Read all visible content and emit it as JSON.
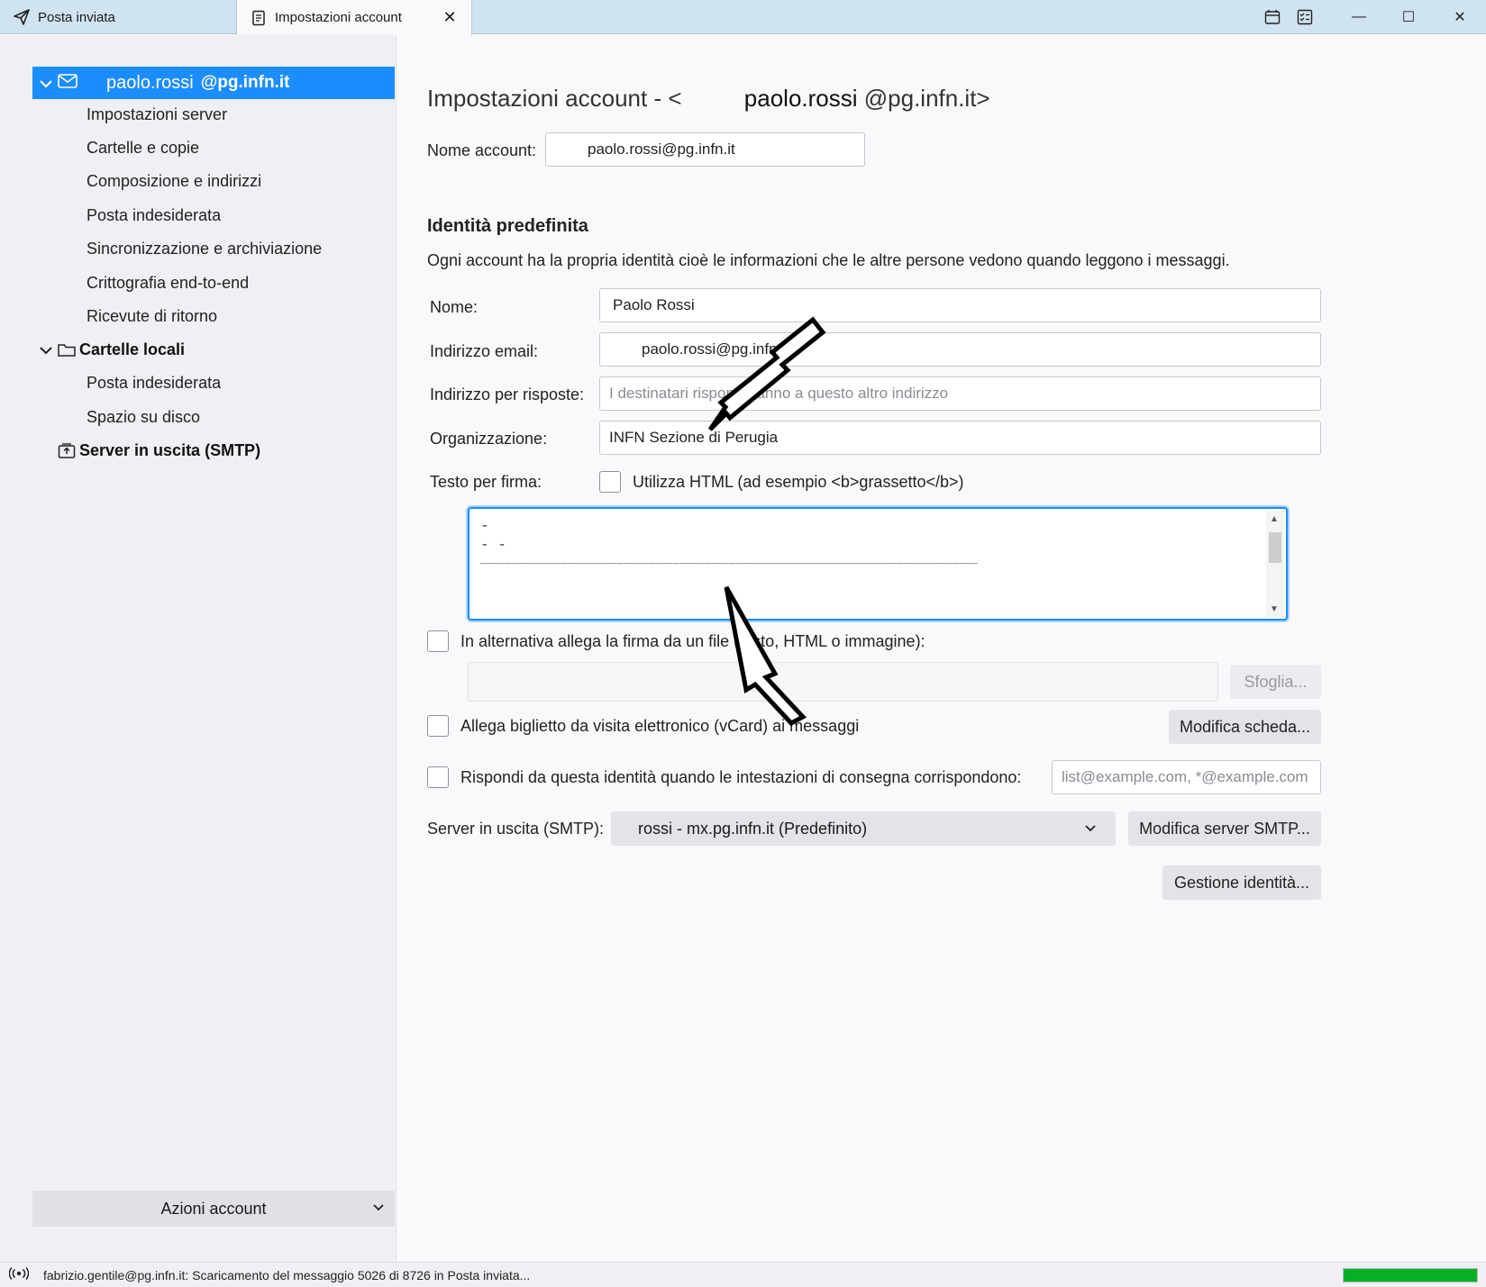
{
  "tabs": [
    {
      "label": "Posta inviata",
      "icon": "send-icon"
    },
    {
      "label": "Impostazioni account",
      "icon": "document-icon"
    }
  ],
  "sidebar": {
    "account": {
      "name": "paolo.rossi",
      "domain": "@pg.infn.it"
    },
    "account_items": [
      "Impostazioni server",
      "Cartelle e copie",
      "Composizione e indirizzi",
      "Posta indesiderata",
      "Sincronizzazione e archiviazione",
      "Crittografia end-to-end",
      "Ricevute di ritorno"
    ],
    "local_folders": {
      "label": "Cartelle locali",
      "items": [
        "Posta indesiderata",
        "Spazio su disco"
      ]
    },
    "smtp": {
      "label": "Server in uscita (SMTP)"
    },
    "actions_label": "Azioni account"
  },
  "main": {
    "title_prefix": "Impostazioni account - <",
    "title_name": "paolo.rossi",
    "title_suffix": "@pg.infn.it>",
    "account_name_label": "Nome account:",
    "account_name_value": "paolo.rossi@pg.infn.it",
    "identity_heading": "Identità predefinita",
    "identity_desc": "Ogni account ha la propria identità cioè le informazioni che le altre persone vedono quando leggono i messaggi.",
    "name_label": "Nome:",
    "name_value": "Paolo Rossi",
    "email_label": "Indirizzo email:",
    "email_value": "paolo.rossi@pg.infn.it",
    "reply_label": "Indirizzo per risposte:",
    "reply_placeholder": "I destinatari risponderanno a questo altro indirizzo",
    "org_label": "Organizzazione:",
    "org_value": "INFN Sezione di Perugia",
    "sig_label": "Testo per firma:",
    "use_html_label": "Utilizza HTML (ad esempio <b>grassetto</b>)",
    "sig_lines": [
      "-",
      "- -",
      "________________________________________________________________________________"
    ],
    "attach_file_label": "In alternativa allega la firma da un file (testo, HTML o immagine):",
    "browse_label": "Sfoglia...",
    "vcard_label": "Allega biglietto da visita elettronico (vCard) ai messaggi",
    "edit_card_label": "Modifica scheda...",
    "reply_identity_label": "Rispondi da questa identità quando le intestazioni di consegna corrispondono:",
    "reply_identity_placeholder": "list@example.com, *@example.com",
    "smtp_label": "Server in uscita (SMTP):",
    "smtp_value": "rossi  - mx.pg.infn.it (Predefinito)",
    "edit_smtp_label": "Modifica server SMTP...",
    "manage_identities_label": "Gestione identità..."
  },
  "status": {
    "text": "fabrizio.gentile@pg.infn.it: Scaricamento del messaggio 5026 di 8726 in Posta inviata...",
    "progress": 1.0
  },
  "colors": {
    "accent": "#1c8dfd",
    "titlebar": "#cfe3f0",
    "progress": "#06b025"
  }
}
